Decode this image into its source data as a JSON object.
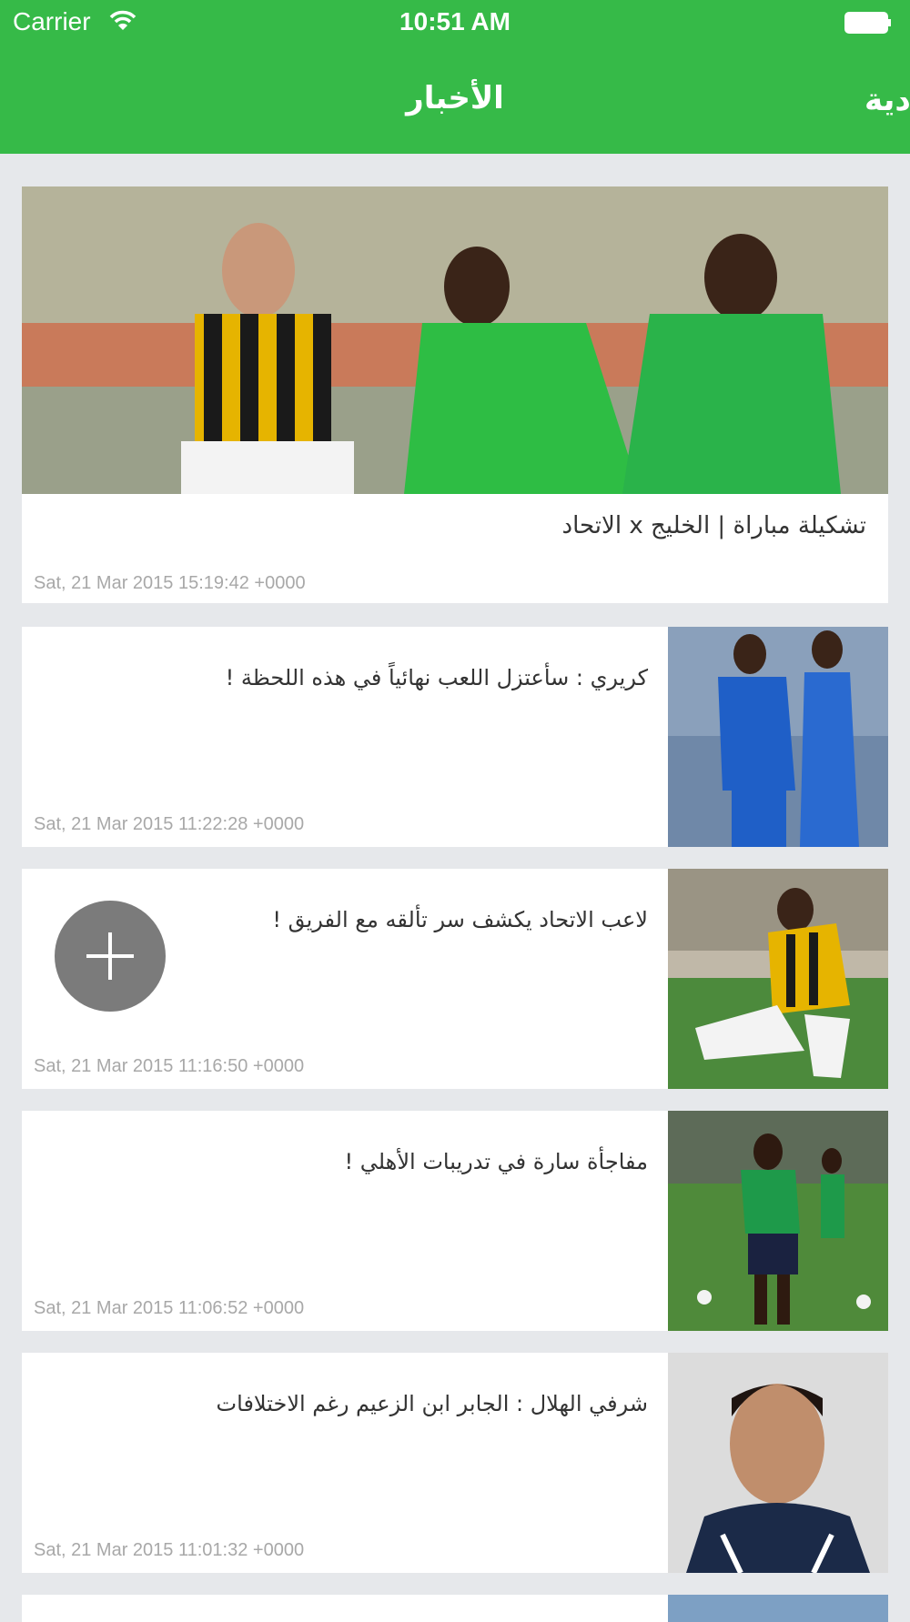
{
  "status_bar": {
    "carrier": "Carrier",
    "time": "10:51 AM"
  },
  "nav_bar": {
    "title": "الأخبار",
    "next_title": "ادية"
  },
  "featured": {
    "headline": "تشكيلة مباراة | الخليج x الاتحاد",
    "timestamp": "Sat, 21 Mar 2015 15:19:42 +0000"
  },
  "articles": [
    {
      "headline": "كريري : سأعتزل اللعب نهائياً في هذه اللحظة !",
      "timestamp": "Sat, 21 Mar 2015 11:22:28 +0000"
    },
    {
      "headline": "لاعب الاتحاد يكشف سر تألقه مع الفريق !",
      "timestamp": "Sat, 21 Mar 2015 11:16:50 +0000"
    },
    {
      "headline": "مفاجأة سارة في تدريبات الأهلي !",
      "timestamp": "Sat, 21 Mar 2015 11:06:52 +0000"
    },
    {
      "headline": "شرفي الهلال : الجابر ابن الزعيم رغم الاختلافات",
      "timestamp": "Sat, 21 Mar 2015 11:01:32 +0000"
    }
  ],
  "icons": {
    "fab": "plus-icon",
    "wifi": "wifi-icon",
    "battery": "battery-icon"
  },
  "colors": {
    "brand": "#36ba48",
    "background": "#e6e8eb",
    "fab": "#7b7b7b"
  }
}
